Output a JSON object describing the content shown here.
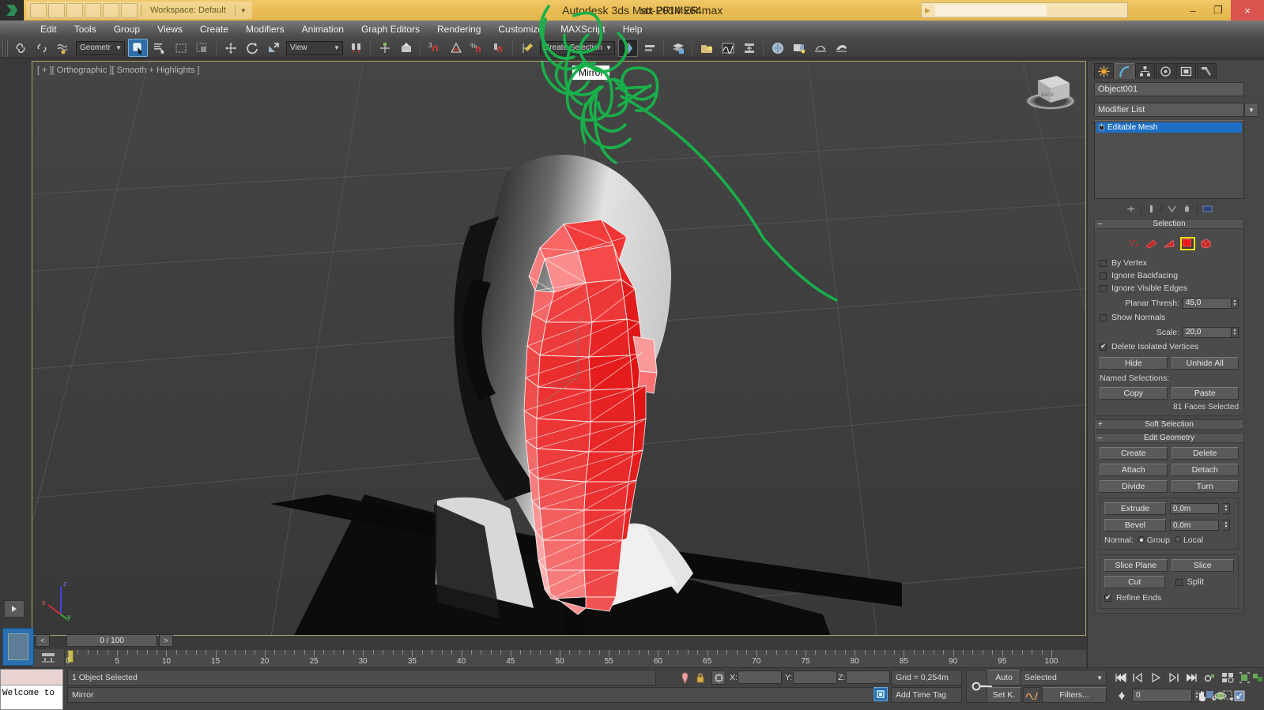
{
  "titlebar": {
    "workspace": "Workspace: Default",
    "app_title": "Autodesk 3ds Max  2014 x64",
    "filename": "stt-PRIMER.max",
    "min": "–",
    "max": "❐",
    "close": "×"
  },
  "menu": {
    "items": [
      "Edit",
      "Tools",
      "Group",
      "Views",
      "Create",
      "Modifiers",
      "Animation",
      "Graph Editors",
      "Rendering",
      "Customize",
      "MAXScript",
      "Help"
    ]
  },
  "toolbar": {
    "selection_filter": "Geometr",
    "ref_coord": "View",
    "named_selection": "Create Selection S",
    "undo_label": "3"
  },
  "tooltip": {
    "text": "Mirror"
  },
  "viewport": {
    "label": "[ + ][ Orthographic ][ Smooth + Highlights ]",
    "axis_x": "x",
    "axis_y": "y",
    "axis_z": "z"
  },
  "command_panel": {
    "object_name": "Object001",
    "modifier_list": "Modifier List",
    "stack": [
      "Editable Mesh"
    ],
    "selection": {
      "title": "Selection",
      "by_vertex": "By Vertex",
      "ignore_backfacing": "Ignore Backfacing",
      "ignore_visible_edges": "Ignore Visible Edges",
      "planar_thresh_label": "Planar Thresh:",
      "planar_thresh_value": "45,0",
      "show_normals": "Show Normals",
      "scale_label": "Scale:",
      "scale_value": "20,0",
      "delete_isolated": "Delete Isolated Vertices",
      "hide": "Hide",
      "unhide_all": "Unhide All",
      "named_selections": "Named Selections:",
      "copy": "Copy",
      "paste": "Paste",
      "status": "81 Faces Selected",
      "subobject_icons": [
        "vertex-icon",
        "edge-icon",
        "face-icon",
        "polygon-icon",
        "element-icon"
      ],
      "active_subobject": 3
    },
    "soft_selection": {
      "title": "Soft Selection"
    },
    "edit_geometry": {
      "title": "Edit Geometry",
      "create": "Create",
      "delete": "Delete",
      "attach": "Attach",
      "detach": "Detach",
      "divide": "Divide",
      "turn": "Turn",
      "extrude": "Extrude",
      "extrude_value": "0,0m",
      "bevel": "Bevel",
      "bevel_value": "0,0m",
      "normal_label": "Normal:",
      "normal_group": "Group",
      "normal_local": "Local",
      "slice_plane": "Slice Plane",
      "slice": "Slice",
      "cut": "Cut",
      "split": "Split",
      "refine_ends": "Refine Ends"
    }
  },
  "timeline": {
    "frame_display": "0 / 100",
    "prev": "<",
    "next": ">",
    "ticks": [
      "0",
      "5",
      "10",
      "15",
      "20",
      "25",
      "30",
      "35",
      "40",
      "45",
      "50",
      "55",
      "60",
      "65",
      "70",
      "75",
      "80",
      "85",
      "90",
      "95",
      "100"
    ]
  },
  "status": {
    "mini_listener": "Welcome to",
    "object_status": "1 Object Selected",
    "prompt": "Mirror",
    "x_label": "X:",
    "y_label": "Y:",
    "z_label": "Z:",
    "x_value": "",
    "y_value": "",
    "z_value": "",
    "grid": "Grid = 0,254m",
    "add_time_tag": "Add Time Tag",
    "auto_key": "Auto",
    "set_key": "Set K.",
    "key_filter": "Selected",
    "filters": "Filters...",
    "key_field": "0"
  },
  "colors": {
    "title_bg": "#e8bd55",
    "accent_blue": "#1d6fc4",
    "selection_red": "#f02a2a",
    "annotation_green": "#18b04a",
    "panel_bg": "#474747",
    "viewport_bg": "#3f3f3f"
  }
}
